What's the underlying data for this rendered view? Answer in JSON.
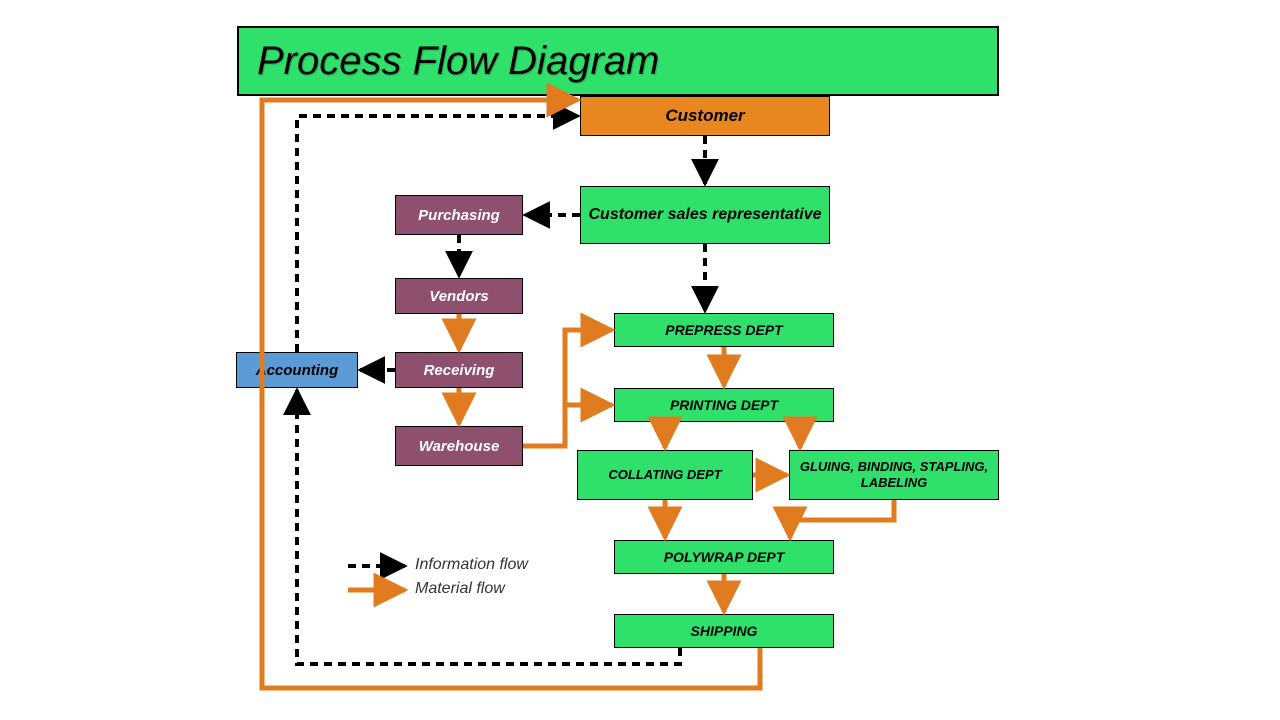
{
  "title": "Process Flow Diagram",
  "boxes": {
    "customer": "Customer",
    "csr": "Customer sales representative",
    "purchasing": "Purchasing",
    "vendors": "Vendors",
    "receiving": "Receiving",
    "warehouse": "Warehouse",
    "accounting": "Accounting",
    "prepress": "PREPRESS DEPT",
    "printing": "PRINTING DEPT",
    "collating": "COLLATING DEPT",
    "gbs": "GLUING, BINDING, STAPLING, LABELING",
    "polywrap": "POLYWRAP DEPT",
    "shipping": "SHIPPING"
  },
  "legend": {
    "info": "Information flow",
    "material": "Material flow"
  },
  "colors": {
    "green": "#2fe06a",
    "orange_box": "#e8861f",
    "purple": "#8f4f6e",
    "blue": "#5b9bd5",
    "material_flow": "#e07b1f",
    "info_flow": "#000000"
  },
  "flows": {
    "information": [
      [
        "customer",
        "customer-sales-representative"
      ],
      [
        "customer-sales-representative",
        "prepress-dept"
      ],
      [
        "customer-sales-representative",
        "purchasing"
      ],
      [
        "purchasing",
        "vendors"
      ],
      [
        "receiving",
        "accounting"
      ],
      [
        "shipping",
        "accounting"
      ],
      [
        "accounting",
        "customer"
      ]
    ],
    "material": [
      [
        "vendors",
        "receiving"
      ],
      [
        "receiving",
        "warehouse"
      ],
      [
        "warehouse",
        "prepress-dept"
      ],
      [
        "warehouse",
        "printing-dept"
      ],
      [
        "prepress-dept",
        "printing-dept"
      ],
      [
        "printing-dept",
        "collating-dept"
      ],
      [
        "printing-dept",
        "gluing-binding-stapling-labeling"
      ],
      [
        "collating-dept",
        "gluing-binding-stapling-labeling"
      ],
      [
        "collating-dept",
        "polywrap-dept"
      ],
      [
        "gluing-binding-stapling-labeling",
        "polywrap-dept"
      ],
      [
        "polywrap-dept",
        "shipping"
      ],
      [
        "shipping",
        "customer"
      ]
    ]
  }
}
